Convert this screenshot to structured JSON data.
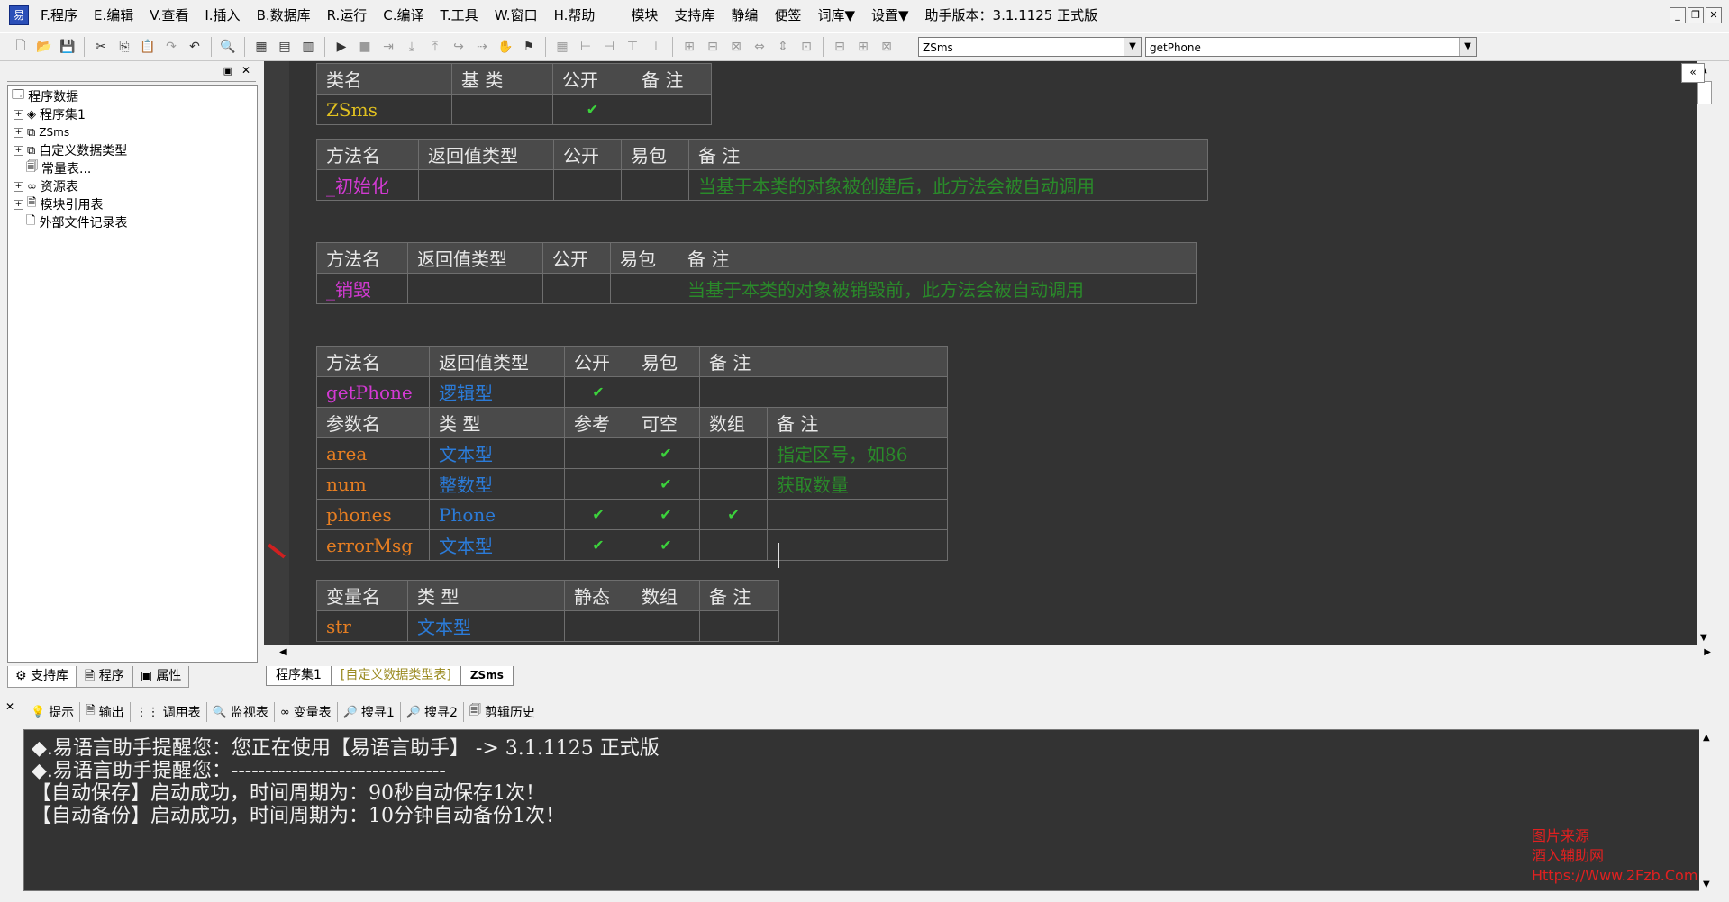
{
  "menu": {
    "items": [
      {
        "label": "F.程序"
      },
      {
        "label": "E.编辑"
      },
      {
        "label": "V.查看"
      },
      {
        "label": "I.插入"
      },
      {
        "label": "B.数据库"
      },
      {
        "label": "R.运行"
      },
      {
        "label": "C.编译"
      },
      {
        "label": "T.工具"
      },
      {
        "label": "W.窗口"
      },
      {
        "label": "H.帮助"
      },
      {
        "label": "模块"
      },
      {
        "label": "支持库"
      },
      {
        "label": "静编"
      },
      {
        "label": "便签"
      },
      {
        "label": "词库▼"
      },
      {
        "label": "设置▼"
      },
      {
        "label": "助手版本：3.1.1125 正式版"
      }
    ]
  },
  "toolbar": {
    "combo1_value": "ZSms",
    "combo2_value": "getPhone"
  },
  "tree": {
    "root": "程序数据",
    "items": [
      {
        "label": "程序集1",
        "icon": "assembly-icon",
        "expandable": true
      },
      {
        "label": "ZSms",
        "icon": "class-icon",
        "expandable": true
      },
      {
        "label": "自定义数据类型",
        "icon": "datatype-icon",
        "expandable": true
      },
      {
        "label": "常量表...",
        "icon": "constant-icon",
        "expandable": false
      },
      {
        "label": "资源表",
        "icon": "resource-icon",
        "expandable": true
      },
      {
        "label": "模块引用表",
        "icon": "module-icon",
        "expandable": true
      },
      {
        "label": "外部文件记录表",
        "icon": "file-icon",
        "expandable": false
      }
    ]
  },
  "left_tabs": [
    "支持库",
    "程序",
    "属性"
  ],
  "class_table": {
    "headers": [
      "类名",
      "基 类",
      "公开",
      "备 注"
    ],
    "row": {
      "name": "ZSms",
      "base": "",
      "public": "✔",
      "note": ""
    }
  },
  "method_init": {
    "headers": [
      "方法名",
      "返回值类型",
      "公开",
      "易包",
      "备 注"
    ],
    "row": {
      "name": "_初始化",
      "type": "",
      "public": "",
      "easy": "",
      "note": "当基于本类的对象被创建后，此方法会被自动调用"
    }
  },
  "method_destroy": {
    "headers": [
      "方法名",
      "返回值类型",
      "公开",
      "易包",
      "备 注"
    ],
    "row": {
      "name": "_销毁",
      "type": "",
      "public": "",
      "easy": "",
      "note": "当基于本类的对象被销毁前，此方法会被自动调用"
    }
  },
  "method_get": {
    "headers": [
      "方法名",
      "返回值类型",
      "公开",
      "易包",
      "备 注"
    ],
    "row": {
      "name": "getPhone",
      "type": "逻辑型",
      "public": "✔",
      "easy": "",
      "note": ""
    },
    "param_headers": [
      "参数名",
      "类 型",
      "参考",
      "可空",
      "数组",
      "备 注"
    ],
    "params": [
      {
        "name": "area",
        "type": "文本型",
        "ref": "",
        "nullable": "✔",
        "array": "",
        "note": "指定区号，如86"
      },
      {
        "name": "num",
        "type": "整数型",
        "ref": "",
        "nullable": "✔",
        "array": "",
        "note": "获取数量"
      },
      {
        "name": "phones",
        "type": "Phone",
        "ref": "✔",
        "nullable": "✔",
        "array": "✔",
        "note": ""
      },
      {
        "name": "errorMsg",
        "type": "文本型",
        "ref": "✔",
        "nullable": "✔",
        "array": "",
        "note": ""
      }
    ]
  },
  "var_table": {
    "headers": [
      "变量名",
      "类 型",
      "静态",
      "数组",
      "备 注"
    ],
    "row": {
      "name": "str",
      "type": "文本型",
      "static": "",
      "array": "",
      "note": ""
    }
  },
  "editor_tabs": [
    "程序集1",
    "[自定义数据类型表]",
    "ZSms"
  ],
  "bottom_tabs": [
    {
      "label": "提示",
      "icon": "hint-icon"
    },
    {
      "label": "输出",
      "icon": "output-icon"
    },
    {
      "label": "调用表",
      "icon": "calltable-icon"
    },
    {
      "label": "监视表",
      "icon": "watch-icon"
    },
    {
      "label": "变量表",
      "icon": "variable-icon"
    },
    {
      "label": "搜寻1",
      "icon": "search1-icon"
    },
    {
      "label": "搜寻2",
      "icon": "search2-icon"
    },
    {
      "label": "剪辑历史",
      "icon": "clip-history-icon"
    }
  ],
  "output": {
    "lines": [
      "◆.易语言助手提醒您：您正在使用【易语言助手】 ->  3.1.1125 正式版",
      "◆.易语言助手提醒您：--------------------------------",
      "【自动保存】启动成功，时间周期为：90秒自动保存1次！",
      "【自动备份】启动成功，时间周期为：10分钟自动备份1次！"
    ]
  },
  "watermark": {
    "lines": [
      "图片来源",
      "酒入辅助网",
      "Https://Www.2Fzb.Com"
    ]
  }
}
